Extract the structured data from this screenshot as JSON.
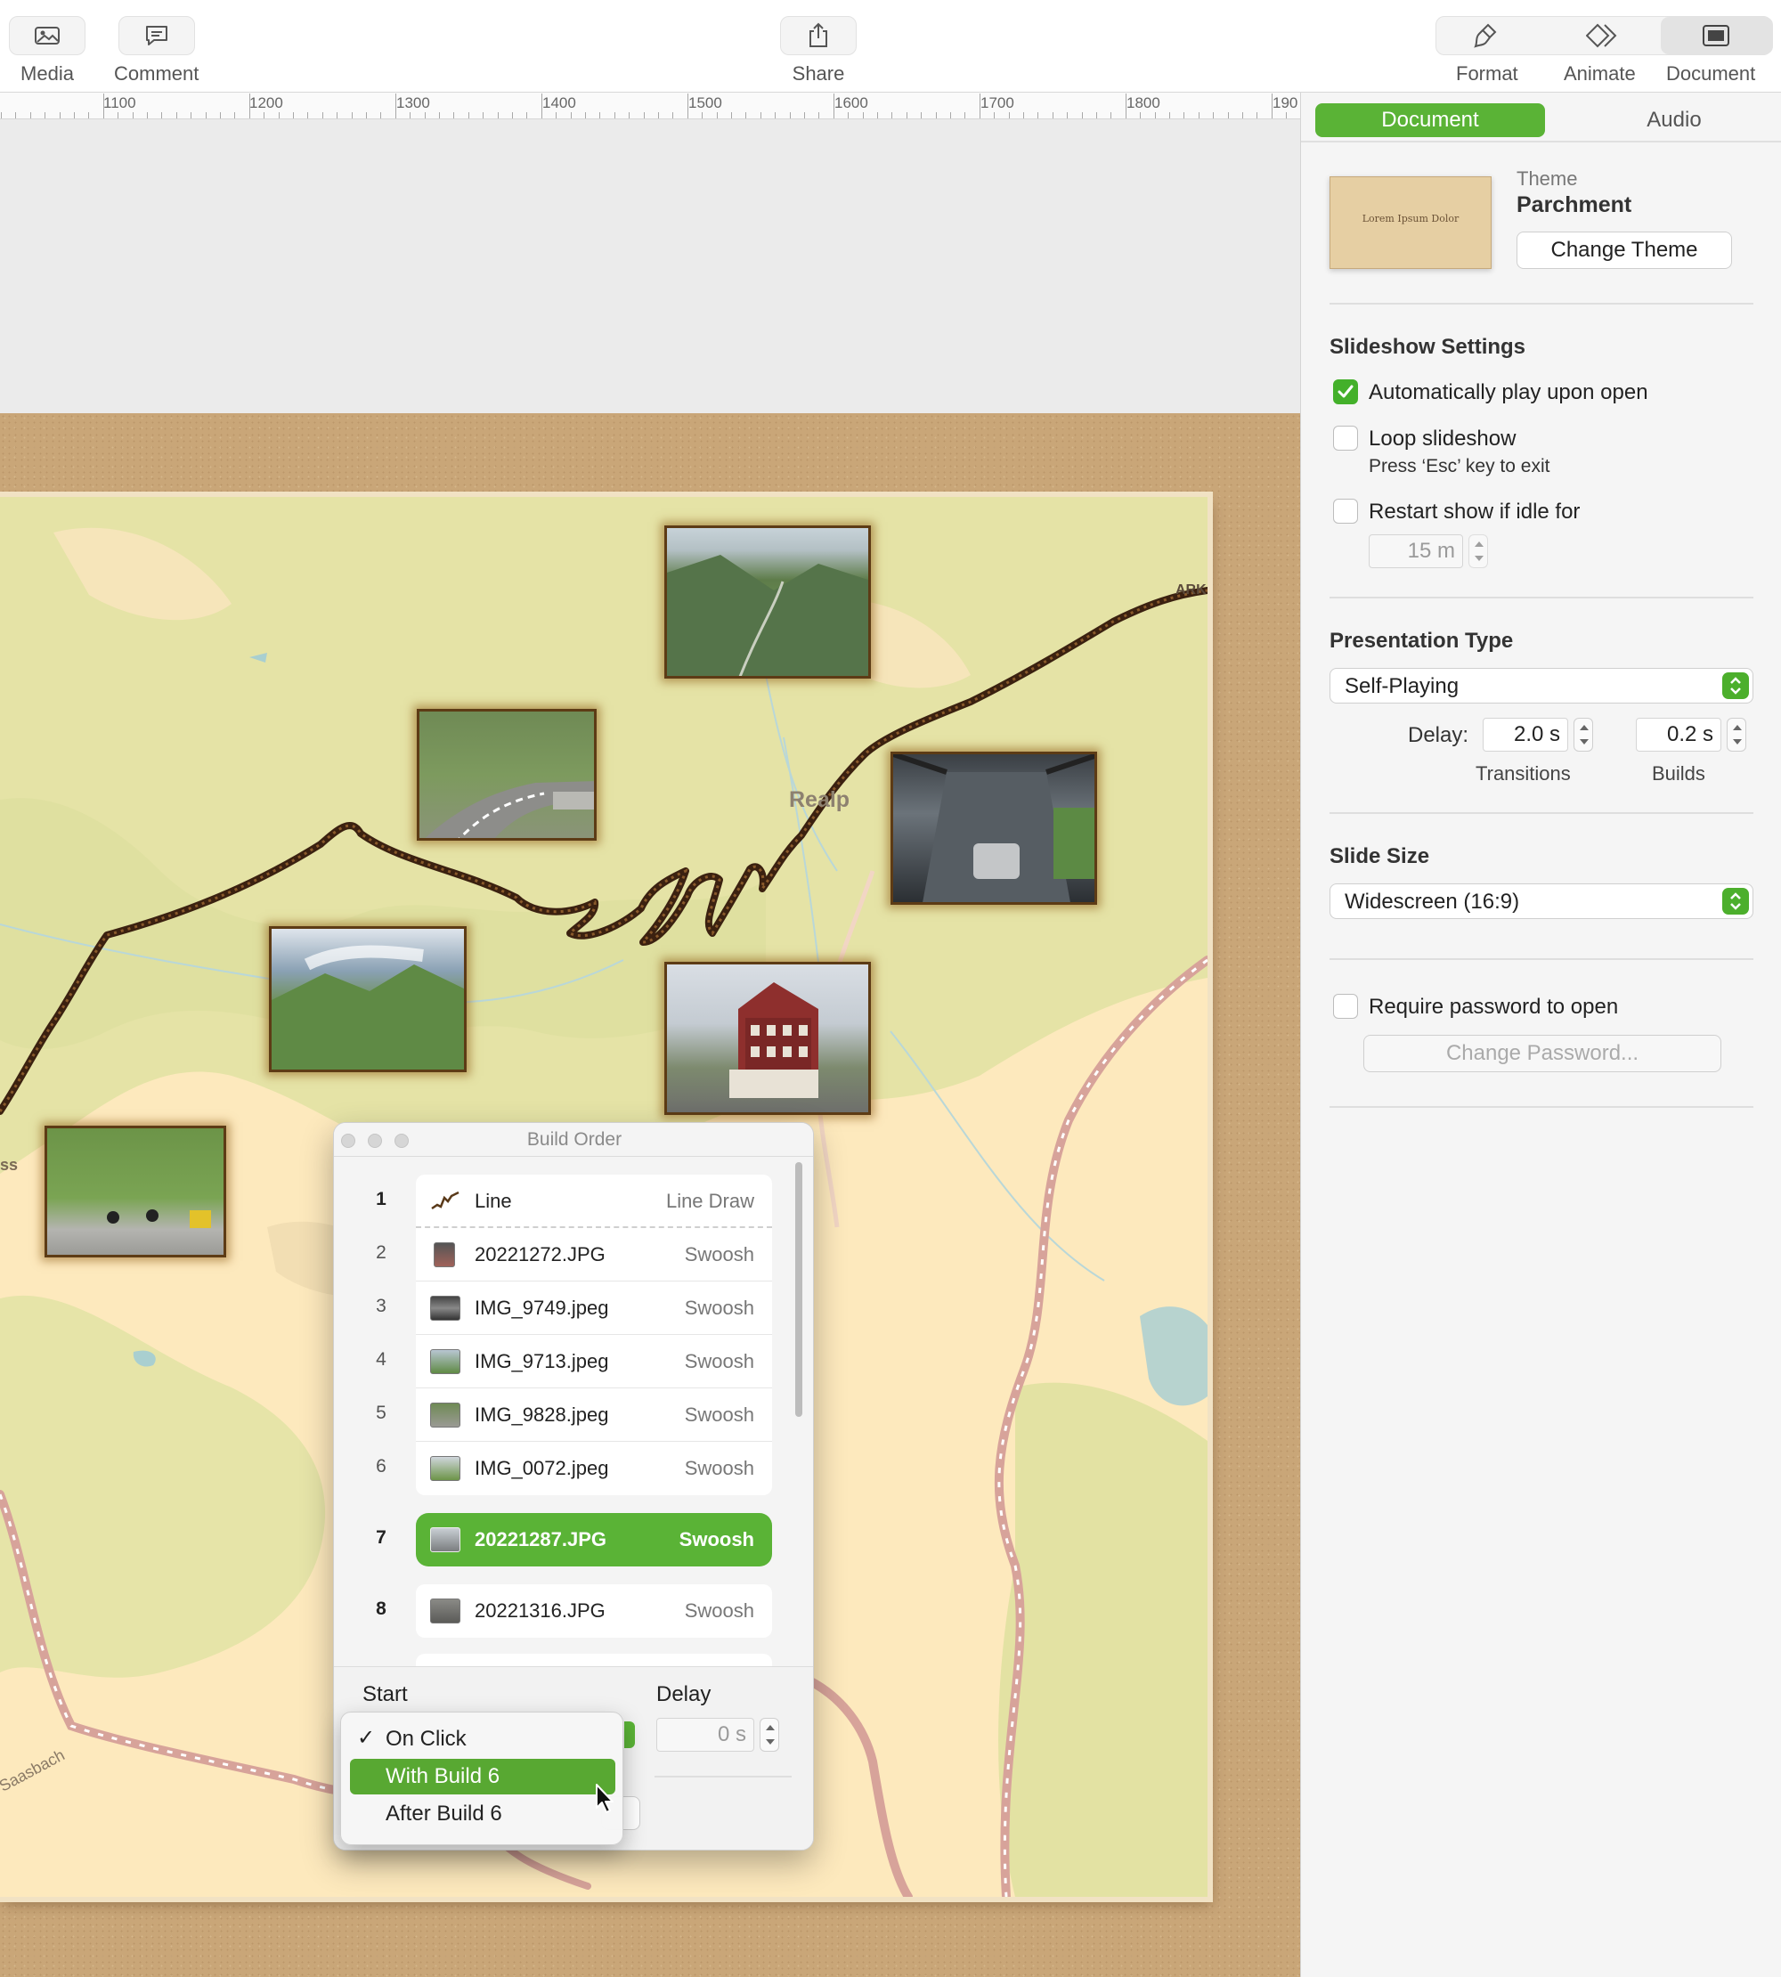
{
  "toolbar": {
    "media": "Media",
    "comment": "Comment",
    "share": "Share",
    "format": "Format",
    "animate": "Animate",
    "document": "Document"
  },
  "ruler": {
    "labels": [
      "1100",
      "1200",
      "1300",
      "1400",
      "1500",
      "1600",
      "1700",
      "1800",
      "190"
    ]
  },
  "map": {
    "place_realp": "Realp",
    "place_ark": "ARK",
    "place_ss": "ss",
    "place_saasbach": "Saasbach"
  },
  "build_order": {
    "title": "Build Order",
    "rows": [
      {
        "num": "1",
        "name": "Line",
        "effect": "Line Draw"
      },
      {
        "num": "2",
        "name": "20221272.JPG",
        "effect": "Swoosh"
      },
      {
        "num": "3",
        "name": "IMG_9749.jpeg",
        "effect": "Swoosh"
      },
      {
        "num": "4",
        "name": "IMG_9713.jpeg",
        "effect": "Swoosh"
      },
      {
        "num": "5",
        "name": "IMG_9828.jpeg",
        "effect": "Swoosh"
      },
      {
        "num": "6",
        "name": "IMG_0072.jpeg",
        "effect": "Swoosh"
      },
      {
        "num": "7",
        "name": "20221287.JPG",
        "effect": "Swoosh"
      },
      {
        "num": "8",
        "name": "20221316.JPG",
        "effect": "Swoosh"
      }
    ],
    "selected_row": "7",
    "start_label": "Start",
    "delay_label": "Delay",
    "delay_value": "0 s"
  },
  "start_menu": {
    "items": [
      "On Click",
      "With Build 6",
      "After Build 6"
    ],
    "checked": "On Click",
    "highlighted": "With Build 6"
  },
  "inspector": {
    "tabs": {
      "document": "Document",
      "audio": "Audio"
    },
    "theme_label": "Theme",
    "theme_name": "Parchment",
    "theme_thumb_text": "Lorem Ipsum Dolor",
    "change_theme": "Change Theme",
    "slideshow_settings": "Slideshow Settings",
    "auto_play": "Automatically play upon open",
    "auto_play_checked": true,
    "loop": "Loop slideshow",
    "loop_checked": false,
    "loop_hint": "Press ‘Esc’ key to exit",
    "restart": "Restart show if idle for",
    "restart_checked": false,
    "idle_value": "15 m",
    "presentation_type": "Presentation Type",
    "presentation_value": "Self-Playing",
    "delay_label": "Delay:",
    "transitions_value": "2.0 s",
    "builds_value": "0.2 s",
    "transitions_label": "Transitions",
    "builds_label": "Builds",
    "slide_size": "Slide Size",
    "slide_size_value": "Widescreen (16:9)",
    "require_password": "Require password to open",
    "require_password_checked": false,
    "change_password": "Change Password..."
  },
  "colors": {
    "accent_green": "#5ab336",
    "parchment": "#fde9bd",
    "cork": "#c9a678"
  }
}
